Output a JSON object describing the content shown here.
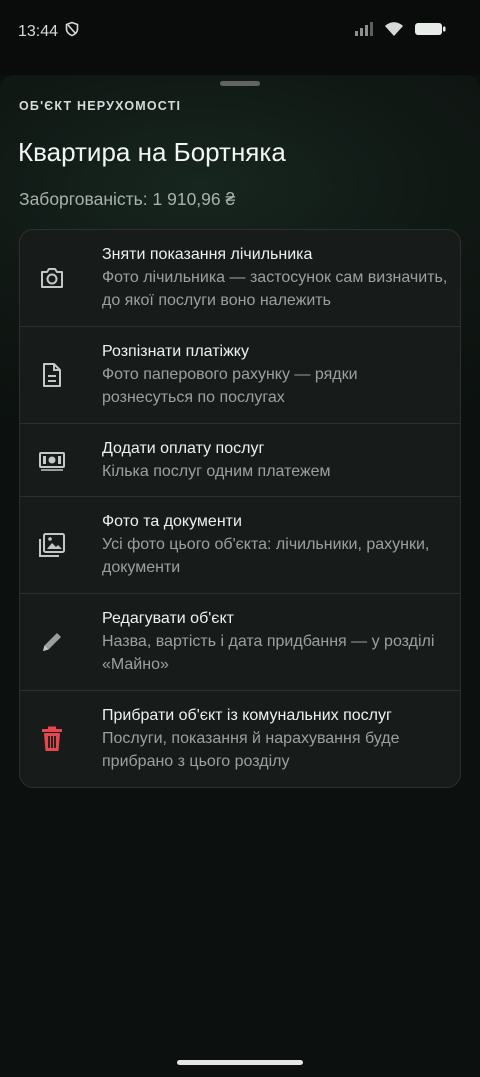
{
  "status_bar": {
    "time": "13:44",
    "icons": [
      "shield-icon",
      "signal-icon",
      "wifi-icon",
      "battery-icon"
    ]
  },
  "sheet": {
    "eyebrow": "ОБ'ЄКТ НЕРУХОМОСТІ",
    "title": "Квартира на Бортняка",
    "debt": "Заборгованість: 1 910,96 ₴"
  },
  "actions": [
    {
      "icon": "camera-icon",
      "title": "Зняти показання лічильника",
      "subtitle": "Фото лічильника — застосунок сам визначить, до якої послуги воно належить"
    },
    {
      "icon": "document-icon",
      "title": "Розпізнати платіжку",
      "subtitle": "Фото паперового рахунку — рядки рознесуться по послугах"
    },
    {
      "icon": "cash-icon",
      "title": "Додати оплату послуг",
      "subtitle": "Кілька послуг одним платежем"
    },
    {
      "icon": "photo-library-icon",
      "title": "Фото та документи",
      "subtitle": "Усі фото цього об'єкта: лічильники, рахунки, документи"
    },
    {
      "icon": "pencil-icon",
      "title": "Редагувати об'єкт",
      "subtitle": "Назва, вартість і дата придбання — у розділі «Майно»"
    },
    {
      "icon": "trash-icon",
      "title": "Прибрати об'єкт із комунальних послуг",
      "subtitle": "Послуги, показання й нарахування буде прибрано з цього розділу"
    }
  ],
  "colors": {
    "danger": "#e5484d",
    "icon": "#c3c8c5",
    "background": "#0b0f0d"
  }
}
